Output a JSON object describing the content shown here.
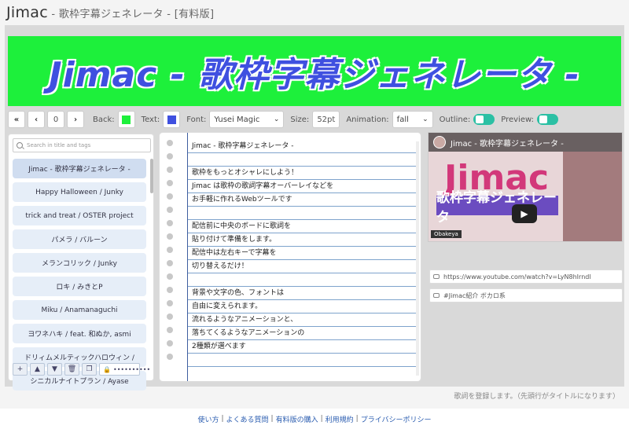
{
  "header": {
    "title": "Jimac",
    "subtitle": " - 歌枠字幕ジェネレータ - [有料版]"
  },
  "banner": {
    "text": "Jimac - 歌枠字幕ジェネレータ -"
  },
  "toolbar": {
    "first_label": "«",
    "prev_label": "‹",
    "index_value": "0",
    "next_label": "›",
    "back_label": "Back:",
    "back_color": "#1df03b",
    "text_label": "Text:",
    "text_color": "#3f50e0",
    "font_label": "Font:",
    "font_value": "Yusei Magic",
    "size_label": "Size:",
    "size_value": "52pt",
    "animation_label": "Animation:",
    "animation_value": "fall",
    "outline_label": "Outline:",
    "preview_label": "Preview:"
  },
  "sidebar": {
    "search_placeholder": "Search in title and tags",
    "items": [
      {
        "label": "Jimac - 歌枠字幕ジェネレータ -"
      },
      {
        "label": "Happy Halloween / Junky"
      },
      {
        "label": "trick and treat / OSTER project"
      },
      {
        "label": "パメラ / バルーン"
      },
      {
        "label": "メランコリック / Junky"
      },
      {
        "label": "ロキ / みきとP"
      },
      {
        "label": "Miku / Anamanaguchi"
      },
      {
        "label": "ヨワネハキ / feat. 和ぬか, asmi"
      },
      {
        "label": "ドリィムメルティックハロウィン /"
      },
      {
        "label": "シニカルナイトプラン / Ayase"
      }
    ],
    "buttons": {
      "add": "+",
      "up": "▲",
      "down": "▼",
      "delete": "🗑",
      "copy": "❐",
      "password": "••••••••••"
    }
  },
  "lyrics": {
    "lines": [
      "Jimac - 歌枠字幕ジェネレータ -",
      "",
      "歌枠をもっとオシャレにしよう！",
      "Jimac は歌枠の歌詞字幕オーバーレイなどを",
      "お手軽に作れるWebツールです",
      "",
      "配信前に中央のボードに歌詞を",
      "貼り付けて準備をします。",
      "配信中は左右キーで字幕を",
      "切り替えるだけ！",
      "",
      "背景や文字の色、フォントは",
      "自由に変えられます。",
      "流れるようなアニメーションと、",
      "落ちてくるようなアニメーションの",
      "2種類が選べます",
      ""
    ]
  },
  "video": {
    "title": "Jimac - 歌枠字幕ジェネレータ -",
    "thumb_title": "Jimac",
    "thumb_subtitle": "歌枠字幕ジェネレータ",
    "brand": "Obakeya",
    "url": "https://www.youtube.com/watch?v=LyN8hIrndl",
    "tags": "#Jimac紹介 ボカロ系"
  },
  "hint": "歌詞を登録します。（先頭行がタイトルになります）",
  "footer": {
    "links": [
      "使い方",
      "よくある質問",
      "有料版の購入",
      "利用規約",
      "プライバシーポリシー"
    ],
    "separator": "|"
  }
}
